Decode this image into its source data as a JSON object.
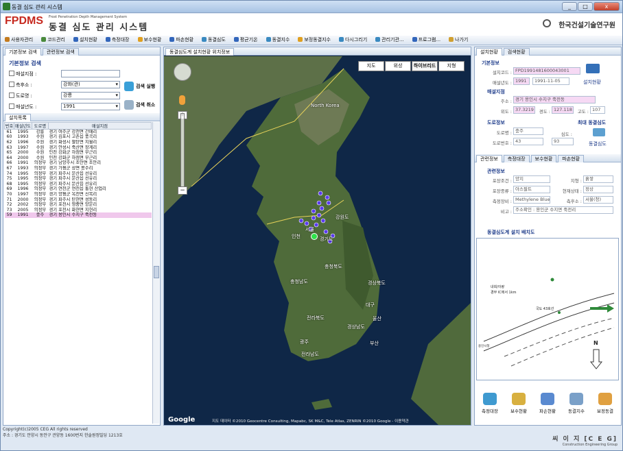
{
  "window": {
    "title": "동결 심도 관리 시스템"
  },
  "header": {
    "logo": "FPDMS",
    "logo_sub": "Frost Penetration Depth Management System",
    "title_kr": "동결 심도 관리 시스템",
    "org": "한국건설기술연구원"
  },
  "menu": [
    {
      "label": "사용자관리",
      "color": "#c47b1e"
    },
    {
      "label": "코드관리",
      "color": "#4a8a3c"
    },
    {
      "label": "설치현황",
      "color": "#3366bb"
    },
    {
      "label": "측정대장",
      "color": "#3366bb"
    },
    {
      "label": "보수현황",
      "color": "#e0a020"
    },
    {
      "label": "파손현황",
      "color": "#3366bb"
    },
    {
      "label": "동결심도",
      "color": "#3a8ac0"
    },
    {
      "label": "평균기온",
      "color": "#3366bb"
    },
    {
      "label": "동결지수",
      "color": "#3a8ac0"
    },
    {
      "label": "보정동결지수",
      "color": "#e0a020"
    },
    {
      "label": "다시그리기",
      "color": "#3a8ac0"
    },
    {
      "label": "관리기관...",
      "color": "#3a8ac0"
    },
    {
      "label": "프로그램...",
      "color": "#3366bb"
    },
    {
      "label": "나가기",
      "color": "#d0a030"
    }
  ],
  "left": {
    "tabs": [
      "기본정보 검색",
      "관련정보 검색"
    ],
    "search_title": "기본정보 검색",
    "fields": [
      {
        "label": "매설지점 :",
        "value": ""
      },
      {
        "label": "측후소 :",
        "value": "강화(관)"
      },
      {
        "label": "도로명 :",
        "value": "강릉"
      },
      {
        "label": "매설년도 :",
        "value": "1991"
      }
    ],
    "search_btn": "검색 실행",
    "cancel_btn": "검색 취소",
    "list_tab": "설치목록",
    "columns": [
      "번호",
      "매설년도",
      "도로명",
      "매설지점"
    ],
    "rows": [
      [
        "61",
        "1995",
        "강릉",
        "경기 여주군 강천면 간매리"
      ],
      [
        "60",
        "1993",
        "수원",
        "경기 김포시 고촌읍 풍곡리"
      ],
      [
        "62",
        "1996",
        "수원",
        "경기 화성시 팔탄면 지월리"
      ],
      [
        "63",
        "1997",
        "수원",
        "경기 안성시 죽산면 장계리"
      ],
      [
        "65",
        "2000",
        "수원",
        "인천 강화군 하점면 부근리"
      ],
      [
        "64",
        "2000",
        "수원",
        "인천 강화군 하점면 부근리"
      ],
      [
        "66",
        "1991",
        "의정부",
        "경기 남양주시 조안면 조안리"
      ],
      [
        "67",
        "1993",
        "의정부",
        "경기 가평군 상면 봉수리"
      ],
      [
        "74",
        "1995",
        "의정부",
        "경기 파주시 문산읍 선유리"
      ],
      [
        "75",
        "1995",
        "의정부",
        "경기 파주시 문산읍 선유리"
      ],
      [
        "68",
        "1995",
        "의정부",
        "경기 파주시 문산읍 선유리"
      ],
      [
        "69",
        "1996",
        "의정부",
        "경기 연천군 연천읍 통현 산업리"
      ],
      [
        "70",
        "1997",
        "의정부",
        "경기 양평군 옥천면 신복리"
      ],
      [
        "71",
        "2000",
        "의정부",
        "경기 파주시 탄현면 성동리"
      ],
      [
        "72",
        "2002",
        "의정부",
        "경기 포천시 영중면 양문리"
      ],
      [
        "73",
        "2005",
        "의정부",
        "경기 포천시 화현면 지현리"
      ],
      [
        "59",
        "1991",
        "충주",
        "경기 용인시 수지구 죽전동"
      ]
    ],
    "selected_index": 16
  },
  "map": {
    "tab": "동결심도계 설치현황 위치정보",
    "types": [
      "지도",
      "위성",
      "하이브리드",
      "지형"
    ],
    "active_type": "하이브리드",
    "places": [
      "North Korea",
      "서울",
      "인천",
      "경기도",
      "충청북도",
      "충청남도",
      "경상북도",
      "전라북도",
      "대구",
      "경상남도",
      "울산",
      "부산",
      "광주",
      "전라남도",
      "강원도"
    ],
    "copyright": "지도 데이터 ©2010 Geocentre Consulting, Mapabc, SK M&C, Tele Atlas, ZENRIN ©2010 Google - 이용약관",
    "google": "Google"
  },
  "right": {
    "tabs": [
      "설치현황",
      "검색현황"
    ],
    "basic_title": "기본정보",
    "install_code_label": "설치코드 :",
    "install_code": "FPD1991481600043001",
    "bury_year_label": "매설년도 :",
    "bury_year": "1991",
    "bury_date": "1991-11-05",
    "install_link": "설치현황",
    "site_title": "매설지점",
    "addr_label": "주소 :",
    "addr": "경기 용인시 수지구 죽전동",
    "lat_label": "위도 :",
    "lat": "37.3219",
    "lon_label": "경도 :",
    "lon": "127.118",
    "alt_label": "고도 :",
    "alt": "107",
    "road_title": "도로정보",
    "max_title": "최대 동결심도",
    "road_name_label": "도로명 :",
    "road_name": "충주",
    "road_no_label": "도로번호 :",
    "road_no": "43",
    "depth_label": "심도 :",
    "depth": "93",
    "freeze_link": "동결심도",
    "rel_tabs": [
      "관련정보",
      "측정대장",
      "보수현황",
      "파손현황"
    ],
    "rel_title": "관련정보",
    "pave_label": "포장조건 :",
    "pave": "양지",
    "geo_label": "지형 :",
    "geo": "흙쌓",
    "ptype_label": "포장종류 :",
    "ptype": "아스팔트",
    "state_label": "현재상태 :",
    "state": "정상",
    "liquid_label": "측정장비 :",
    "liquid": "Methylene Blue",
    "station_label": "측후소 :",
    "station": "서울(청)",
    "note_label": "비고 :",
    "note": "주소확인 : 용인군 수지면 죽전리",
    "layout_title": "동결심도계 설치 배치도",
    "diagram_labels": [
      "내회/이량",
      "경부 IC에서 1km",
      "국도 43호선",
      "용인시청",
      "N"
    ],
    "bottom": [
      "측정대장",
      "보수현황",
      "파손현황",
      "동결지수",
      "보정동결"
    ],
    "ceg": "씨 이 지 [C E G]",
    "ceg_sub": "Construction Engineering Group"
  },
  "status": {
    "line1": "Copyright(c)2005 CEG All rights reserved",
    "line2": "주소 : 경기도 안양시 동안구 관양동 1600번지 한솔원정빌딩 1213호"
  }
}
